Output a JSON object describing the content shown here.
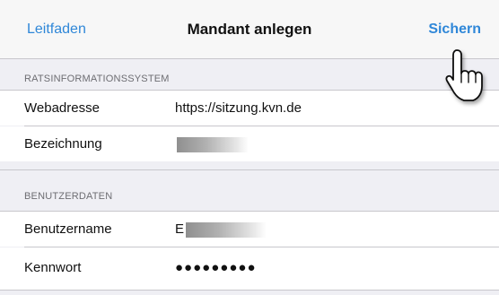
{
  "navbar": {
    "back_label": "Leitfaden",
    "title": "Mandant anlegen",
    "action_label": "Sichern"
  },
  "sections": [
    {
      "header": "RATSINFORMATIONSSYSTEM",
      "rows": [
        {
          "label": "Webadresse",
          "value": "https://sitzung.kvn.de"
        },
        {
          "label": "Bezeichnung",
          "value": ""
        }
      ]
    },
    {
      "header": "BENUTZERDATEN",
      "rows": [
        {
          "label": "Benutzername",
          "value": "E"
        },
        {
          "label": "Kennwort",
          "value": "●●●●●●●●●"
        }
      ]
    }
  ],
  "colors": {
    "accent": "#2f87d8",
    "background": "#efeff4",
    "separator": "#c8c7cc"
  },
  "icons": {
    "cursor": "hand-pointer-icon"
  }
}
